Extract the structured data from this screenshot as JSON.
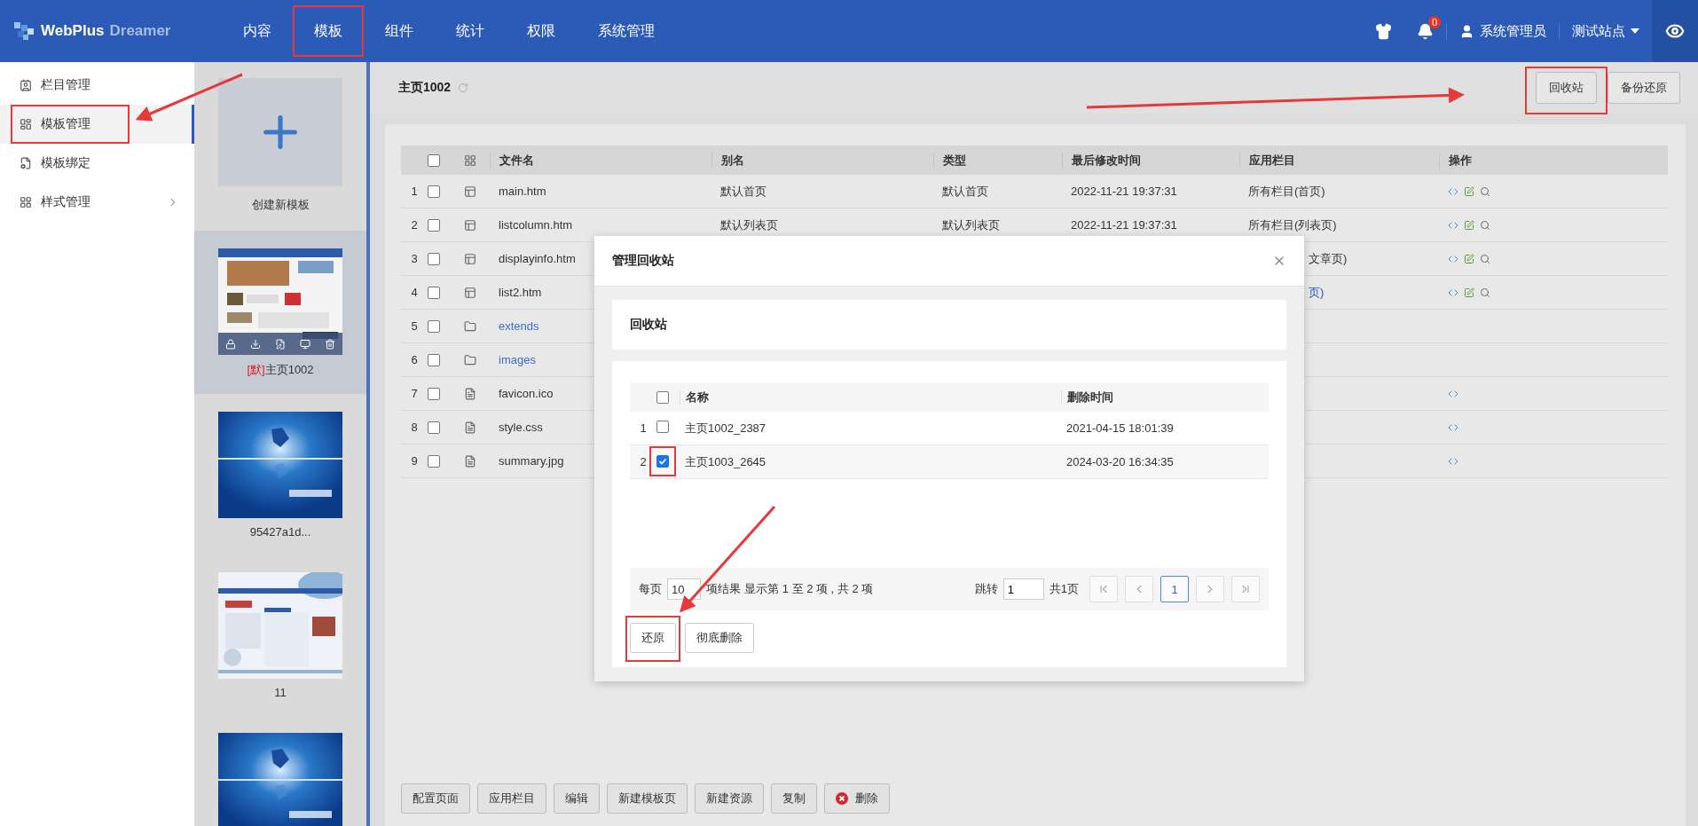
{
  "header": {
    "logo": {
      "name": "WebPlus",
      "sub": "Dreamer"
    },
    "nav": [
      {
        "label": "内容",
        "highlighted": false
      },
      {
        "label": "模板",
        "highlighted": true
      },
      {
        "label": "组件",
        "highlighted": false
      },
      {
        "label": "统计",
        "highlighted": false
      },
      {
        "label": "权限",
        "highlighted": false
      },
      {
        "label": "系统管理",
        "highlighted": false
      }
    ],
    "notifications": "0",
    "user": "系统管理员",
    "site": "测试站点"
  },
  "sidebar": {
    "items": [
      {
        "label": "栏目管理",
        "selected": false,
        "highlighted": false,
        "expandable": false
      },
      {
        "label": "模板管理",
        "selected": true,
        "highlighted": true,
        "expandable": false
      },
      {
        "label": "模板绑定",
        "selected": false,
        "highlighted": false,
        "expandable": false
      },
      {
        "label": "样式管理",
        "selected": false,
        "highlighted": false,
        "expandable": true
      }
    ]
  },
  "templates": {
    "create": {
      "label": "创建新模板"
    },
    "cards": [
      {
        "tag": "[默]",
        "label": "主页1002",
        "selected": true
      },
      {
        "label": "95427a1d...",
        "selected": false
      },
      {
        "label": "11",
        "selected": false
      },
      {
        "selected": false
      }
    ]
  },
  "main": {
    "title": "主页1002",
    "toolbar": [
      {
        "label": "回收站",
        "highlighted": true
      },
      {
        "label": "备份还原",
        "highlighted": false
      }
    ],
    "table": {
      "columns": [
        "文件名",
        "别名",
        "类型",
        "最后修改时间",
        "应用栏目",
        "操作"
      ],
      "header_checked": false,
      "rows": [
        {
          "index": "1",
          "checked": false,
          "kind": "template",
          "name": "main.htm",
          "alias": "默认首页",
          "type": "默认首页",
          "modified": "2022-11-21 19:37:31",
          "applied": {
            "text": "所有栏目(首页)",
            "partial": false,
            "link": false
          }
        },
        {
          "index": "2",
          "checked": false,
          "kind": "template",
          "name": "listcolumn.htm",
          "alias": "默认列表页",
          "type": "默认列表页",
          "modified": "2022-11-21 19:37:31",
          "applied": {
            "text": "所有栏目(列表页)",
            "partial": false,
            "link": false
          }
        },
        {
          "index": "3",
          "checked": false,
          "kind": "template",
          "name": "displayinfo.htm",
          "applied": {
            "text": "文章页)",
            "partial": true,
            "link": false
          }
        },
        {
          "index": "4",
          "checked": false,
          "kind": "template",
          "name": "list2.htm",
          "applied": {
            "text": "页)",
            "partial": true,
            "link": true
          }
        },
        {
          "index": "5",
          "checked": false,
          "kind": "folder",
          "name": "extends"
        },
        {
          "index": "6",
          "checked": false,
          "kind": "folder",
          "name": "images"
        },
        {
          "index": "7",
          "checked": false,
          "kind": "file",
          "name": "favicon.ico"
        },
        {
          "index": "8",
          "checked": false,
          "kind": "file",
          "name": "style.css"
        },
        {
          "index": "9",
          "checked": false,
          "kind": "file",
          "name": "summary.jpg"
        }
      ]
    },
    "buttons": [
      {
        "label": "配置页面",
        "kind": "plain"
      },
      {
        "label": "应用栏目",
        "kind": "plain"
      },
      {
        "label": "编辑",
        "kind": "plain"
      },
      {
        "label": "新建模板页",
        "kind": "plain"
      },
      {
        "label": "新建资源",
        "kind": "plain"
      },
      {
        "label": "复制",
        "kind": "plain"
      },
      {
        "label": "删除",
        "kind": "danger"
      }
    ]
  },
  "modal": {
    "title": "管理回收站",
    "section_title": "回收站",
    "columns": [
      "名称",
      "删除时间"
    ],
    "header_checked": false,
    "rows": [
      {
        "index": "1",
        "checked": false,
        "highlighted": false,
        "name": "主页1002_2387",
        "deleted": "2021-04-15 18:01:39"
      },
      {
        "index": "2",
        "checked": true,
        "highlighted": true,
        "name": "主页1003_2645",
        "deleted": "2024-03-20 16:34:35"
      }
    ],
    "pagination": {
      "per_page_label": "每页",
      "per_page": "10",
      "summary": "项结果 显示第 1 至 2 项 , 共 2 项",
      "jump_label": "跳转",
      "jump_value": "1",
      "total_pages": "共1页",
      "pages": [
        {
          "label": "1",
          "selected": true
        }
      ]
    },
    "buttons": [
      {
        "label": "还原",
        "highlighted": true
      },
      {
        "label": "彻底删除",
        "highlighted": false
      }
    ]
  }
}
